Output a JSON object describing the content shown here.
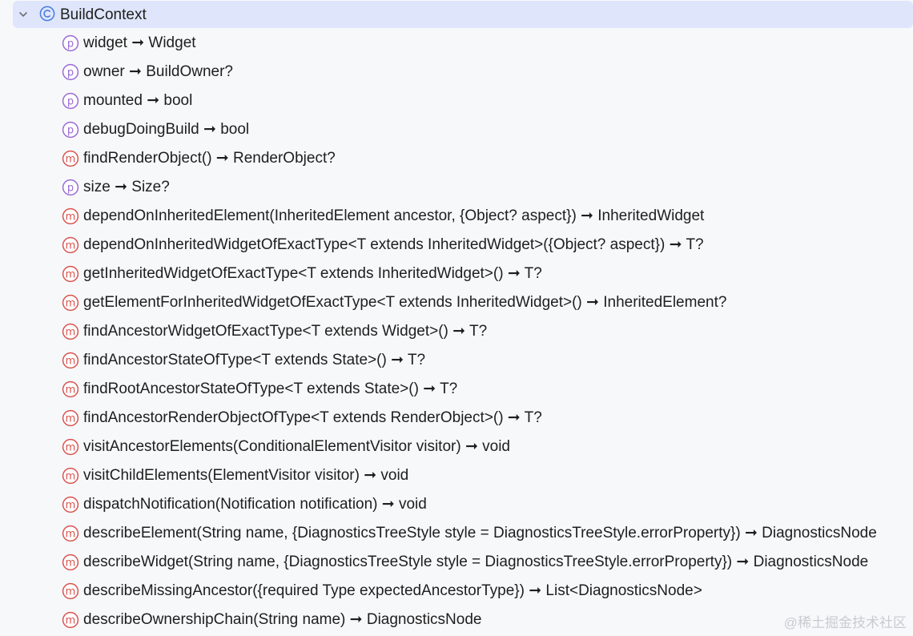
{
  "root": {
    "label": "BuildContext",
    "icon": "class-icon",
    "expanded": true
  },
  "members": [
    {
      "kind": "property",
      "label": "widget ➞ Widget"
    },
    {
      "kind": "property",
      "label": "owner ➞ BuildOwner?"
    },
    {
      "kind": "property",
      "label": "mounted ➞ bool"
    },
    {
      "kind": "property",
      "label": "debugDoingBuild ➞ bool"
    },
    {
      "kind": "method",
      "label": "findRenderObject() ➞ RenderObject?"
    },
    {
      "kind": "property",
      "label": "size ➞ Size?"
    },
    {
      "kind": "method",
      "label": "dependOnInheritedElement(InheritedElement ancestor, {Object? aspect}) ➞ InheritedWidget"
    },
    {
      "kind": "method",
      "label": "dependOnInheritedWidgetOfExactType<T extends InheritedWidget>({Object? aspect}) ➞ T?"
    },
    {
      "kind": "method",
      "label": "getInheritedWidgetOfExactType<T extends InheritedWidget>() ➞ T?"
    },
    {
      "kind": "method",
      "label": "getElementForInheritedWidgetOfExactType<T extends InheritedWidget>() ➞ InheritedElement?"
    },
    {
      "kind": "method",
      "label": "findAncestorWidgetOfExactType<T extends Widget>() ➞ T?"
    },
    {
      "kind": "method",
      "label": "findAncestorStateOfType<T extends State>() ➞ T?"
    },
    {
      "kind": "method",
      "label": "findRootAncestorStateOfType<T extends State>() ➞ T?"
    },
    {
      "kind": "method",
      "label": "findAncestorRenderObjectOfType<T extends RenderObject>() ➞ T?"
    },
    {
      "kind": "method",
      "label": "visitAncestorElements(ConditionalElementVisitor visitor) ➞ void"
    },
    {
      "kind": "method",
      "label": "visitChildElements(ElementVisitor visitor) ➞ void"
    },
    {
      "kind": "method",
      "label": "dispatchNotification(Notification notification) ➞ void"
    },
    {
      "kind": "method",
      "label": "describeElement(String name, {DiagnosticsTreeStyle style = DiagnosticsTreeStyle.errorProperty}) ➞ DiagnosticsNode"
    },
    {
      "kind": "method",
      "label": "describeWidget(String name, {DiagnosticsTreeStyle style = DiagnosticsTreeStyle.errorProperty}) ➞ DiagnosticsNode"
    },
    {
      "kind": "method",
      "label": "describeMissingAncestor({required Type expectedAncestorType}) ➞ List<DiagnosticsNode>"
    },
    {
      "kind": "method",
      "label": "describeOwnershipChain(String name) ➞ DiagnosticsNode"
    }
  ],
  "icons": {
    "property": {
      "name": "property-icon",
      "letter": "p",
      "color": "#9a6ad6"
    },
    "method": {
      "name": "method-icon",
      "letter": "m",
      "color": "#d9534f"
    },
    "class": {
      "name": "class-icon",
      "letter": "C",
      "color": "#4a7be0"
    }
  },
  "watermark": "@稀土掘金技术社区"
}
